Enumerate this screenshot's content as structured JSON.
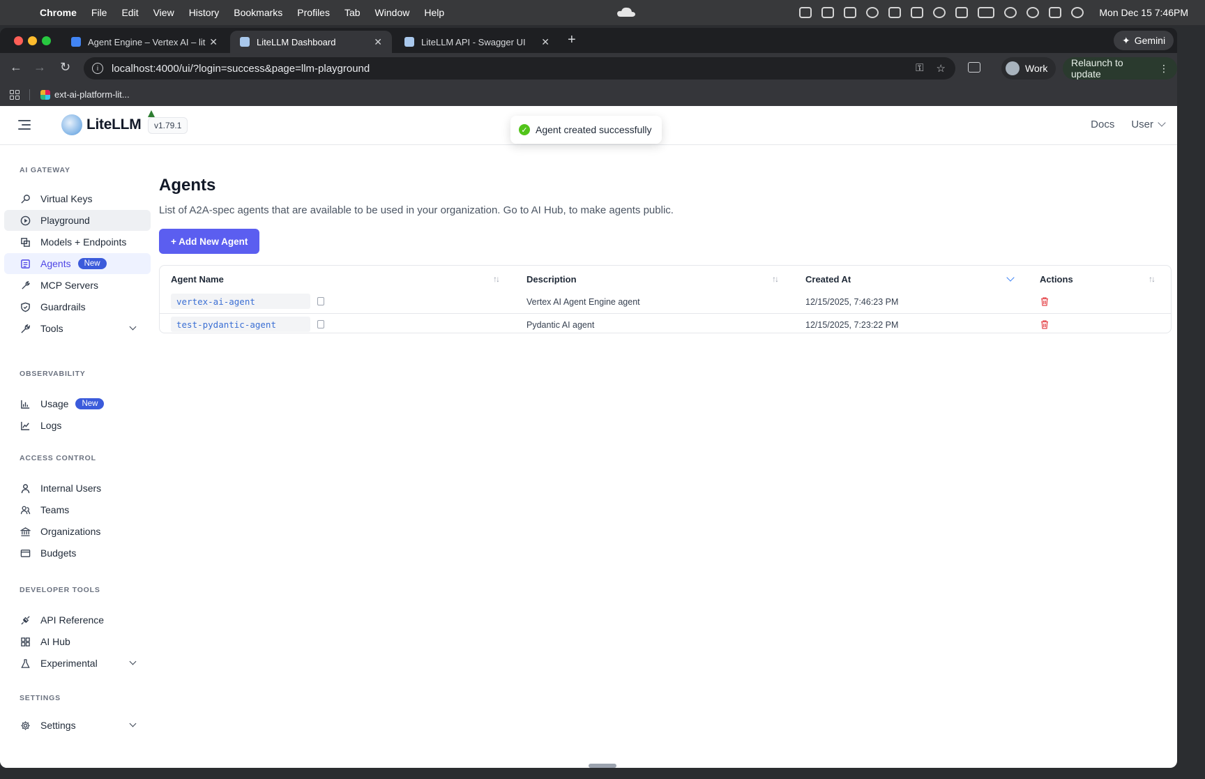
{
  "menubar": {
    "items": [
      "Chrome",
      "File",
      "Edit",
      "View",
      "History",
      "Bookmarks",
      "Profiles",
      "Tab",
      "Window",
      "Help"
    ],
    "clock": "Mon Dec 15  7:46PM"
  },
  "browser": {
    "tabs": [
      {
        "title": "Agent Engine – Vertex AI – lit"
      },
      {
        "title": "LiteLLM Dashboard"
      },
      {
        "title": "LiteLLM API - Swagger UI"
      }
    ],
    "gemini_label": "Gemini",
    "url": "localhost:4000/ui/?login=success&page=llm-playground",
    "profile_label": "Work",
    "relaunch_label": "Relaunch to update",
    "bookmark_label": "ext-ai-platform-lit..."
  },
  "header": {
    "brand": "LiteLLM",
    "version": "v1.79.1",
    "toast": "Agent created successfully",
    "docs_label": "Docs",
    "user_label": "User"
  },
  "sidebar": {
    "sections": [
      {
        "title": "AI GATEWAY",
        "items": [
          {
            "label": "Virtual Keys",
            "icon": "key-icon"
          },
          {
            "label": "Playground",
            "icon": "play-circle-icon"
          },
          {
            "label": "Models + Endpoints",
            "icon": "blocks-icon"
          },
          {
            "label": "Agents",
            "icon": "robot-icon",
            "badge": "New"
          },
          {
            "label": "MCP Servers",
            "icon": "tool-icon"
          },
          {
            "label": "Guardrails",
            "icon": "shield-icon"
          },
          {
            "label": "Tools",
            "icon": "wrench-icon"
          }
        ]
      },
      {
        "title": "OBSERVABILITY",
        "items": [
          {
            "label": "Usage",
            "icon": "bar-chart-icon",
            "badge": "New"
          },
          {
            "label": "Logs",
            "icon": "line-chart-icon"
          }
        ]
      },
      {
        "title": "ACCESS CONTROL",
        "items": [
          {
            "label": "Internal Users",
            "icon": "user-icon"
          },
          {
            "label": "Teams",
            "icon": "team-icon"
          },
          {
            "label": "Organizations",
            "icon": "bank-icon"
          },
          {
            "label": "Budgets",
            "icon": "wallet-icon"
          }
        ]
      },
      {
        "title": "DEVELOPER TOOLS",
        "items": [
          {
            "label": "API Reference",
            "icon": "api-icon"
          },
          {
            "label": "AI Hub",
            "icon": "grid-icon"
          },
          {
            "label": "Experimental",
            "icon": "flask-icon"
          }
        ]
      },
      {
        "title": "SETTINGS",
        "items": [
          {
            "label": "Settings",
            "icon": "gear-icon"
          }
        ]
      }
    ]
  },
  "main": {
    "title": "Agents",
    "subtitle": "List of A2A-spec agents that are available to be used in your organization. Go to AI Hub, to make agents public.",
    "add_button": "+ Add New Agent",
    "table": {
      "columns": [
        "Agent Name",
        "Description",
        "Created At",
        "Actions"
      ],
      "rows": [
        {
          "name": "vertex-ai-agent",
          "description": "Vertex AI Agent Engine agent",
          "created_at": "12/15/2025, 7:46:23 PM"
        },
        {
          "name": "test-pydantic-agent",
          "description": "Pydantic AI agent",
          "created_at": "12/15/2025, 7:23:22 PM"
        }
      ]
    }
  },
  "colors": {
    "accent": "#5b5ef0",
    "active_nav_text": "#4f46e5",
    "badge": "#3b5bdb",
    "delete": "#e5484d",
    "success": "#52c41a"
  }
}
